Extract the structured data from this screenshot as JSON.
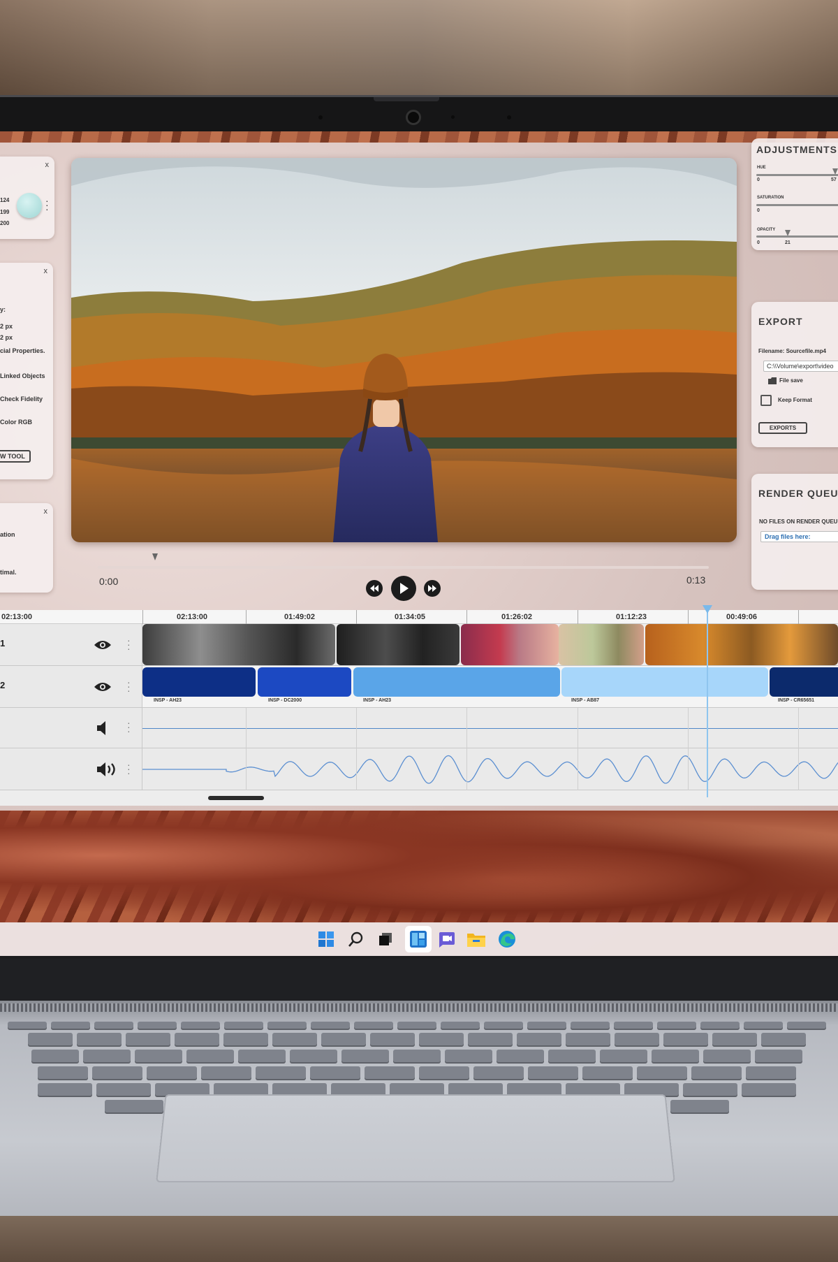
{
  "left_panel_1": {
    "close": "x",
    "values": [
      "124",
      "199",
      "200"
    ]
  },
  "left_panel_2": {
    "close": "x",
    "lines": [
      "y:",
      "2 px",
      "2 px",
      "cial Properties.",
      "Linked Objects",
      "Check Fidelity",
      "Color RGB"
    ],
    "button_label": "W TOOL"
  },
  "left_panel_3": {
    "close": "x",
    "lines": [
      "ation",
      "timal."
    ]
  },
  "adjustments": {
    "title": "ADJUSTMENTS",
    "hue": {
      "label": "HUE",
      "min": "0",
      "max": "57"
    },
    "saturation": {
      "label": "SATURATION",
      "min": "0"
    },
    "opacity": {
      "label": "OPACITY",
      "min": "0",
      "value": "21"
    }
  },
  "export": {
    "title": "EXPORT",
    "filename": "Filename: Sourcefile.mp4",
    "path": "C:\\\\Volume\\export\\video",
    "file_save": "File save",
    "keep_format": "Keep Format",
    "button": "EXPORTS"
  },
  "render_queue": {
    "title": "RENDER QUEUE",
    "status": "NO FILES ON RENDER QUEUE",
    "drag_label": "Drag files here:"
  },
  "player": {
    "current_time": "0:00",
    "total_time": "0:13"
  },
  "timeline": {
    "ruler": [
      "02:13:00",
      "02:13:00",
      "01:49:02",
      "01:34:05",
      "01:26:02",
      "01:12:23",
      "00:49:06"
    ],
    "tracks": [
      {
        "num": "1",
        "type": "video"
      },
      {
        "num": "2",
        "type": "color"
      },
      {
        "num": "",
        "type": "audio-muted"
      },
      {
        "num": "",
        "type": "audio"
      }
    ],
    "color_clips": [
      {
        "label": "INSP - AH23",
        "color": "#0d2f86"
      },
      {
        "label": "INSP - DC2000",
        "color": "#1c49c2"
      },
      {
        "label": "INSP - AH23",
        "color": "#5aa5e8"
      },
      {
        "label": "INSP - AB87",
        "color": "#a7d6fa"
      },
      {
        "label": "INSP - CR65651",
        "color": "#0c2a6c"
      }
    ]
  },
  "taskbar": {
    "icons": [
      "windows-start-icon",
      "search-icon",
      "task-view-icon",
      "widgets-icon",
      "teams-chat-icon",
      "file-explorer-icon",
      "edge-browser-icon"
    ]
  }
}
